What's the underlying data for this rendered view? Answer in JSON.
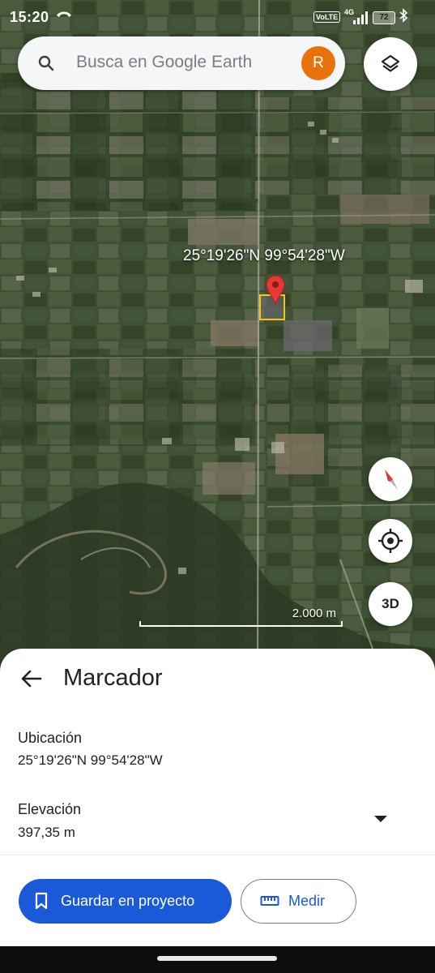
{
  "status_bar": {
    "time": "15:20",
    "call_icon": "call-icon",
    "volte": "VoLTE",
    "network": "4G",
    "battery": "72",
    "bluetooth_icon": "bluetooth-icon"
  },
  "search": {
    "placeholder": "Busca en Google Earth",
    "avatar_initial": "R"
  },
  "map": {
    "coordinate_label": "25°19'26\"N 99°54'28\"W",
    "scale_label": "2.000 m",
    "controls": {
      "layers_icon": "layers-icon",
      "compass_icon": "compass-icon",
      "locate_icon": "my-location-icon",
      "three_d_label": "3D"
    },
    "colors": {
      "pin": "#e53935",
      "parcel_outline": "#f5c518"
    }
  },
  "sheet": {
    "title": "Marcador",
    "location_label": "Ubicación",
    "location_value": "25°19'26\"N 99°54'28\"W",
    "elevation_label": "Elevación",
    "elevation_value": "397,35 m",
    "save_button": "Guardar en proyecto",
    "measure_button": "Medir",
    "accent": "#1a5ad9"
  }
}
